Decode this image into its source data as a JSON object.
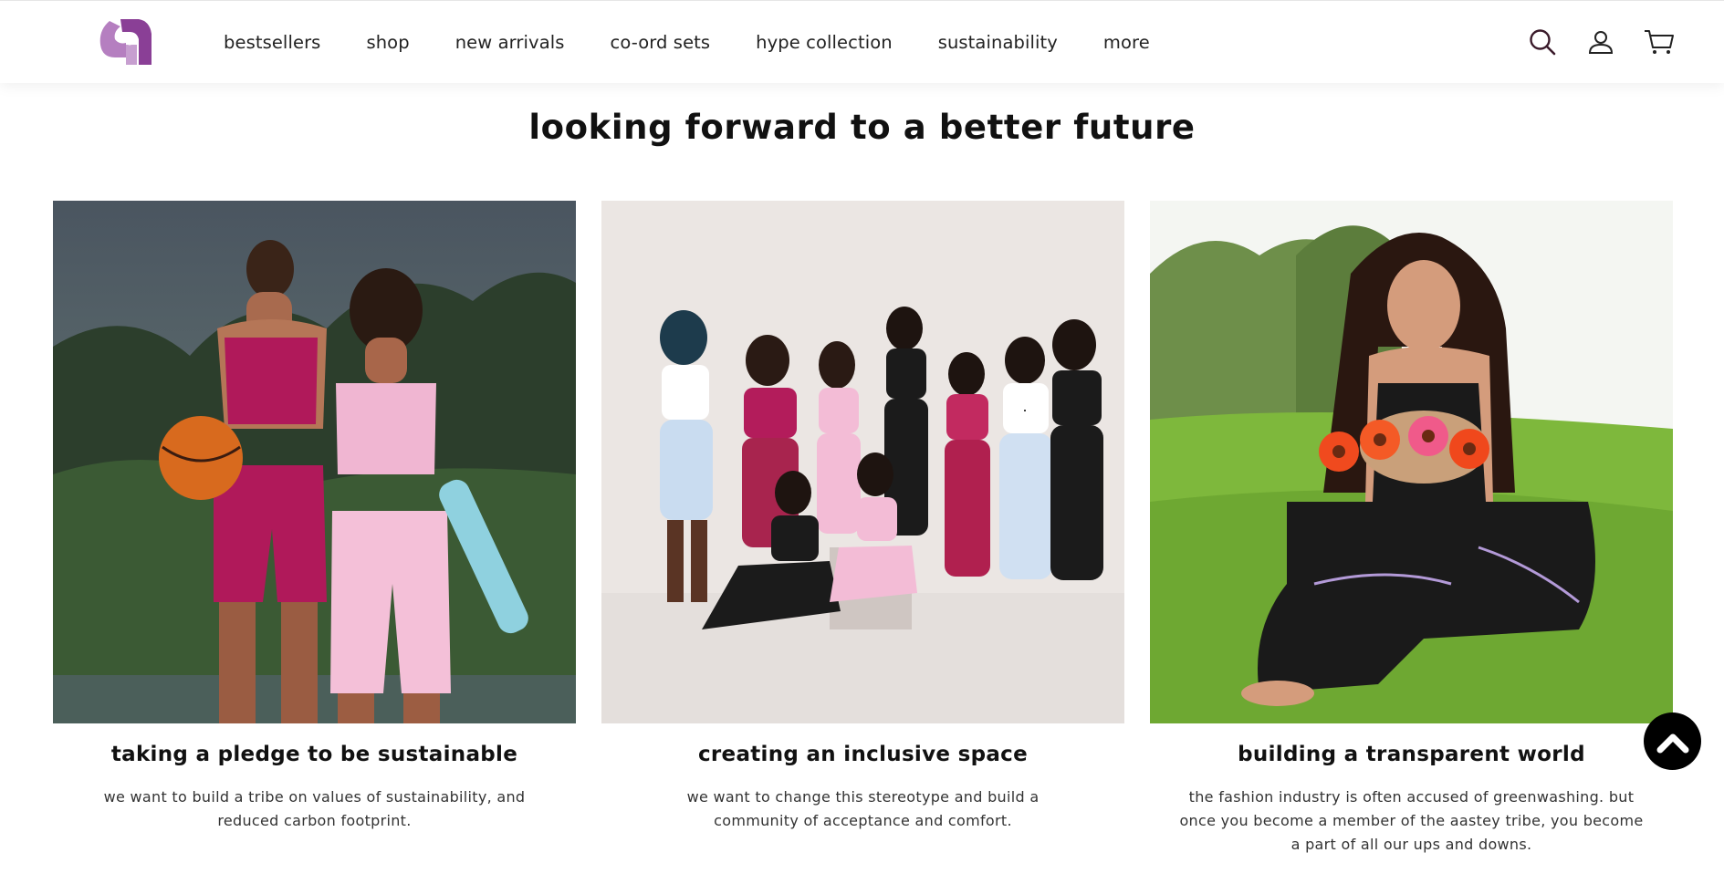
{
  "nav": {
    "items": [
      {
        "label": "bestsellers"
      },
      {
        "label": "shop"
      },
      {
        "label": "new arrivals"
      },
      {
        "label": "co-ord sets"
      },
      {
        "label": "hype collection"
      },
      {
        "label": "sustainability"
      },
      {
        "label": "more"
      }
    ]
  },
  "header_icons": [
    "search-icon",
    "account-icon",
    "cart-icon"
  ],
  "section": {
    "title": "looking forward to a better future"
  },
  "cards": [
    {
      "title": "taking a pledge to be sustainable",
      "text": "we want to build a tribe on values of sustainability, and reduced carbon footprint."
    },
    {
      "title": "creating an inclusive space",
      "text": "we want to change this stereotype and build a community of acceptance and comfort."
    },
    {
      "title": "building a transparent world",
      "text": "the fashion industry is often accused of greenwashing. but once you become a member of the aastey tribe, you become a part of all our ups and downs."
    }
  ],
  "colors": {
    "brand_logo": "#a05ba8",
    "scroll_button": "#000000"
  }
}
